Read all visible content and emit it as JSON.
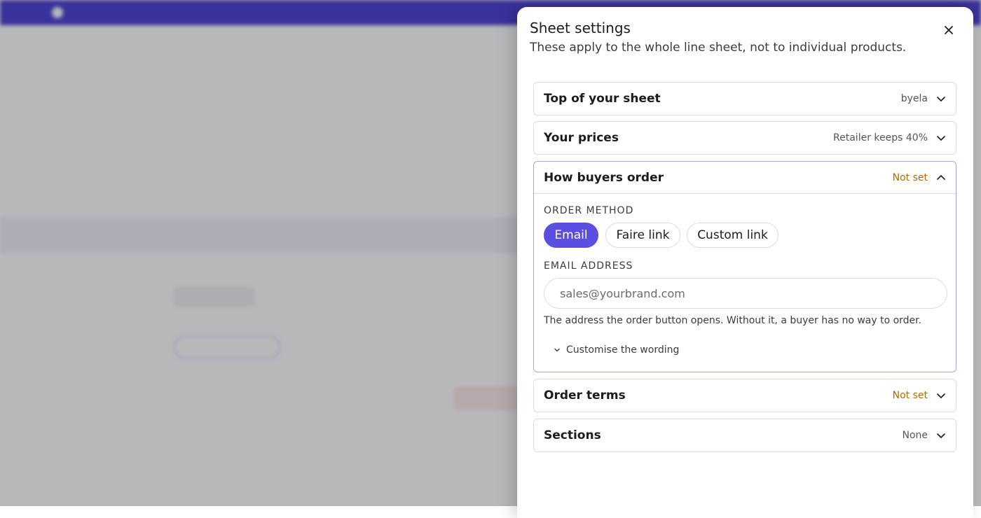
{
  "drawer": {
    "title": "Sheet settings",
    "subtitle": "These apply to the whole line sheet, not to individual products.",
    "close_icon": "close-icon"
  },
  "sections": {
    "top": {
      "title": "Top of your sheet",
      "value": "byela"
    },
    "prices": {
      "title": "Your prices",
      "value": "Retailer keeps 40%"
    },
    "order": {
      "title": "How buyers order",
      "value": "Not set",
      "order_method_label": "ORDER METHOD",
      "methods": [
        "Email",
        "Faire link",
        "Custom link"
      ],
      "selected_method": "Email",
      "email_label": "EMAIL ADDRESS",
      "email_placeholder": "sales@yourbrand.com",
      "email_value": "",
      "help": "The address the order button opens. Without it, a buyer has no way to order.",
      "customise": "Customise the wording"
    },
    "terms": {
      "title": "Order terms",
      "value": "Not set"
    },
    "sections": {
      "title": "Sections",
      "value": "None"
    }
  },
  "colors": {
    "accent": "#5a4fe0",
    "warn": "#b06a00",
    "banner": "#4a3fd0"
  }
}
